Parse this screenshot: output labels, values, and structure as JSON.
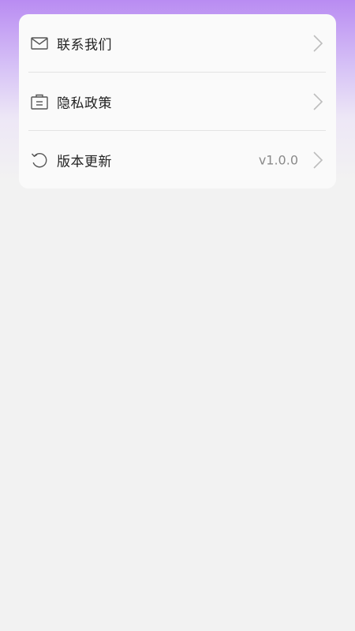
{
  "menu": {
    "items": [
      {
        "icon": "mail-icon",
        "label": "联系我们",
        "value": ""
      },
      {
        "icon": "briefcase-document-icon",
        "label": "隐私政策",
        "value": ""
      },
      {
        "icon": "refresh-icon",
        "label": "版本更新",
        "value": "v1.0.0"
      }
    ]
  },
  "colors": {
    "gradient_top": "#b98cf2",
    "page_background": "#f2f2f2",
    "card_background": "#fafafa",
    "label_text": "#222222",
    "value_text": "#8a8a8a",
    "icon_stroke": "#555555",
    "chevron": "#bdbdbd",
    "divider": "#e3e3e3"
  }
}
